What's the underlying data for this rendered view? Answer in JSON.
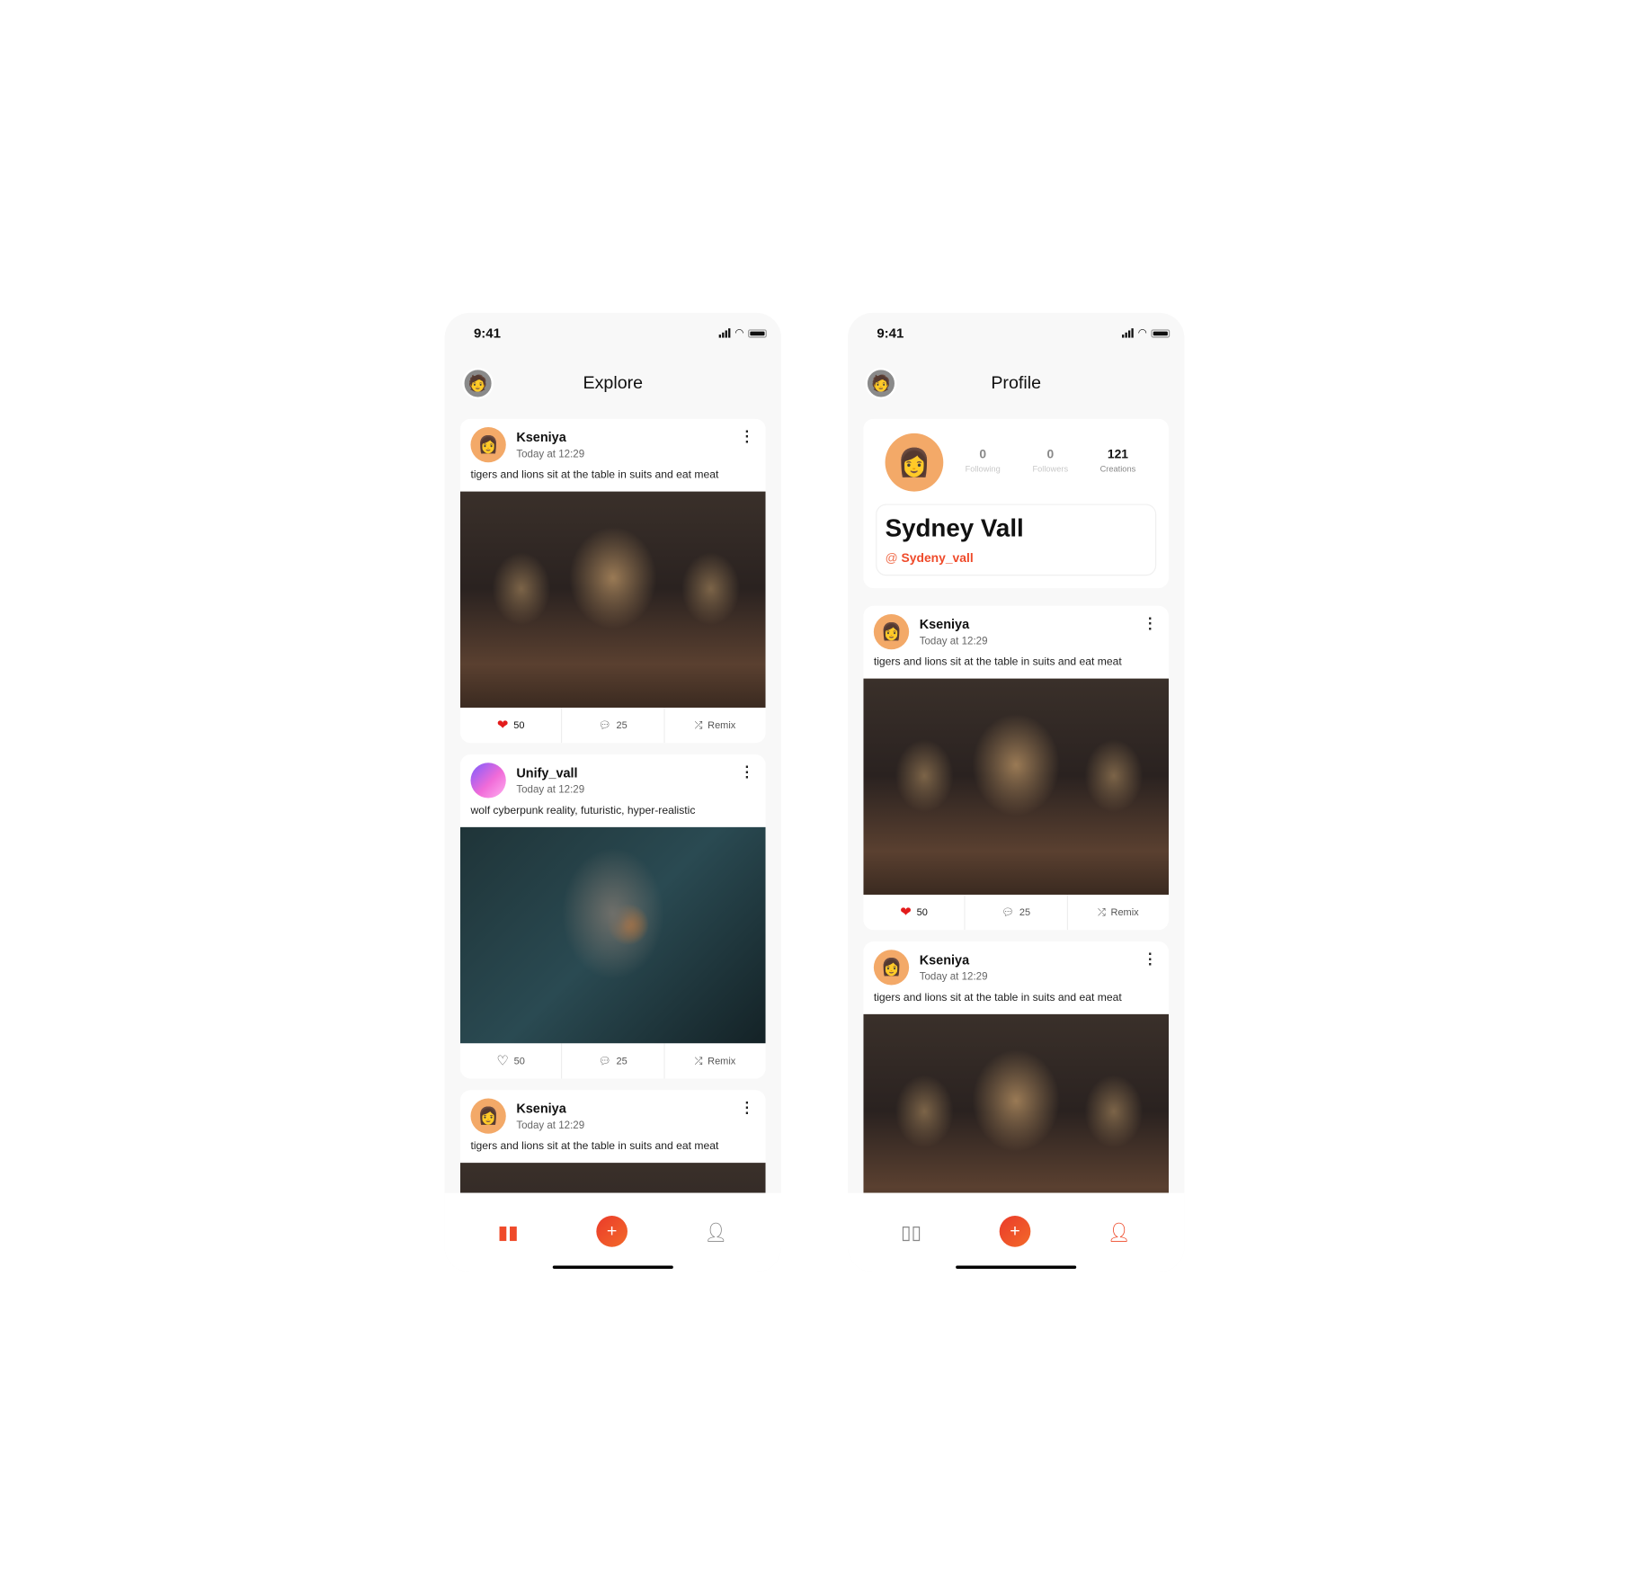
{
  "status_bar": {
    "time": "9:41"
  },
  "colors": {
    "accent": "#EF4A2A",
    "like": "#E31B1B",
    "background": "#F8F8F8"
  },
  "explore": {
    "title": "Explore",
    "posts": [
      {
        "author": "Kseniya",
        "time": "Today at 12:29",
        "caption": "tigers and lions sit at the table in suits and eat meat",
        "likes": "50",
        "comments": "25",
        "remix": "Remix",
        "liked": true,
        "image": "lions-in-suits"
      },
      {
        "author": "Unify_vall",
        "time": "Today at 12:29",
        "caption": "wolf cyberpunk reality, futuristic, hyper-realistic",
        "likes": "50",
        "comments": "25",
        "remix": "Remix",
        "liked": false,
        "image": "cyberpunk-wolf"
      },
      {
        "author": "Kseniya",
        "time": "Today at 12:29",
        "caption": "tigers and lions sit at the table in suits and eat meat",
        "image": "lions-in-suits"
      }
    ],
    "nav_active": "explore"
  },
  "profile": {
    "title": "Profile",
    "name": "Sydney Vall",
    "handle_prefix": "@",
    "handle": "Sydeny_vall",
    "stats": [
      {
        "value": "0",
        "label": "Following"
      },
      {
        "value": "0",
        "label": "Followers"
      },
      {
        "value": "121",
        "label": "Creations"
      }
    ],
    "posts": [
      {
        "author": "Kseniya",
        "time": "Today at 12:29",
        "caption": "tigers and lions sit at the table in suits and eat meat",
        "likes": "50",
        "comments": "25",
        "remix": "Remix",
        "liked": true,
        "image": "lions-in-suits"
      },
      {
        "author": "Kseniya",
        "time": "Today at 12:29",
        "caption": "tigers and lions sit at the table in suits and eat meat",
        "image": "lions-in-suits"
      }
    ],
    "nav_active": "profile"
  },
  "nav": {
    "plus": "+",
    "icons": [
      "binoculars-icon",
      "plus-icon",
      "user-icon"
    ]
  }
}
